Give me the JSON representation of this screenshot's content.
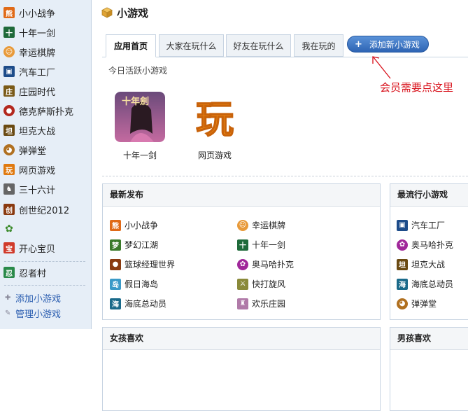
{
  "sidebar": {
    "items": [
      {
        "label": "小小战争",
        "icon": "bear-icon",
        "color": "#e06a18"
      },
      {
        "label": "十年一剑",
        "icon": "sword-icon",
        "color": "#1f6a3a"
      },
      {
        "label": "幸运棋牌",
        "icon": "face-icon",
        "color": "#e89a3a"
      },
      {
        "label": "汽车工厂",
        "icon": "film-icon",
        "color": "#1d4c8a"
      },
      {
        "label": "庄园时代",
        "icon": "manor-icon",
        "color": "#7a5a18"
      },
      {
        "label": "德克萨斯扑克",
        "icon": "soccer-icon",
        "color": "#b3281e"
      },
      {
        "label": "坦克大战",
        "icon": "tank-icon",
        "color": "#6a4a12"
      },
      {
        "label": "弹弹堂",
        "icon": "dog-icon",
        "color": "#b07020"
      },
      {
        "label": "网页游戏",
        "icon": "play-icon",
        "color": "#e07a10"
      },
      {
        "label": "三十六计",
        "icon": "cow-icon",
        "color": "#666666"
      },
      {
        "label": "创世纪2012",
        "icon": "genesis-icon",
        "color": "#8a3a10"
      },
      {
        "label": "",
        "icon": "sprout-icon",
        "color": "#3a8a2a"
      },
      {
        "label": "开心宝贝",
        "icon": "baby-icon",
        "color": "#d03a2a"
      },
      {
        "label": "忍者村",
        "icon": "ninja-icon",
        "color": "#2a8a4a"
      }
    ],
    "tools": [
      {
        "label": "添加小游戏",
        "icon": "plus-icon"
      },
      {
        "label": "管理小游戏",
        "icon": "wrench-icon"
      }
    ]
  },
  "header": {
    "title": "小游戏"
  },
  "tabs": [
    {
      "label": "应用首页",
      "active": true
    },
    {
      "label": "大家在玩什么",
      "active": false
    },
    {
      "label": "好友在玩什么",
      "active": false
    },
    {
      "label": "我在玩的",
      "active": false
    }
  ],
  "add_button": {
    "label": "添加新小游戏"
  },
  "annotation": {
    "text": "会员需要点这里"
  },
  "today": {
    "label": "今日活跃小游戏",
    "games": [
      {
        "name": "十年一剑",
        "thumb": "sword-lady"
      },
      {
        "name": "网页游戏",
        "thumb": "play-char"
      }
    ]
  },
  "panels": {
    "latest": {
      "title": "最新发布",
      "items": [
        {
          "label": "小小战争",
          "icon": "bear-icon",
          "color": "#e06a18"
        },
        {
          "label": "幸运棋牌",
          "icon": "face-icon",
          "color": "#e89a3a"
        },
        {
          "label": "梦幻江湖",
          "icon": "hat-icon",
          "color": "#3a7a2a"
        },
        {
          "label": "十年一剑",
          "icon": "sword-icon",
          "color": "#1f6a3a"
        },
        {
          "label": "篮球经理世界",
          "icon": "basketball-icon",
          "color": "#8a3a10"
        },
        {
          "label": "奥马哈扑克",
          "icon": "flower-icon",
          "color": "#a0289a"
        },
        {
          "label": "假日海岛",
          "icon": "island-icon",
          "color": "#3a9ac8"
        },
        {
          "label": "快打旋风",
          "icon": "swords-icon",
          "color": "#8a8a3a"
        },
        {
          "label": "海底总动员",
          "icon": "sea-icon",
          "color": "#1a6a8a"
        },
        {
          "label": "欢乐庄园",
          "icon": "castle-icon",
          "color": "#b07aa8"
        }
      ]
    },
    "popular": {
      "title": "最流行小游戏",
      "items": [
        {
          "label": "汽车工厂",
          "icon": "film-icon",
          "color": "#1d4c8a"
        },
        {
          "label": "奥马哈扑克",
          "icon": "flower-icon",
          "color": "#a0289a"
        },
        {
          "label": "坦克大战",
          "icon": "tank-icon",
          "color": "#6a4a12"
        },
        {
          "label": "海底总动员",
          "icon": "sea-icon",
          "color": "#1a6a8a"
        },
        {
          "label": "弹弹堂",
          "icon": "dog-icon",
          "color": "#b07020"
        }
      ]
    },
    "girls": {
      "title": "女孩喜欢"
    },
    "boys": {
      "title": "男孩喜欢"
    }
  }
}
